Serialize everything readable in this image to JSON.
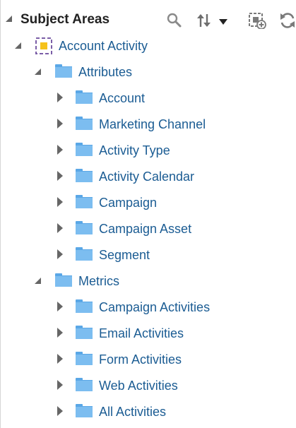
{
  "header": {
    "title": "Subject Areas"
  },
  "tree": {
    "root": {
      "label": "Account Activity",
      "icon": "subject-area-icon"
    },
    "attributes": {
      "label": "Attributes",
      "items": [
        {
          "label": "Account"
        },
        {
          "label": "Marketing Channel"
        },
        {
          "label": "Activity Type"
        },
        {
          "label": "Activity Calendar"
        },
        {
          "label": "Campaign"
        },
        {
          "label": "Campaign Asset"
        },
        {
          "label": "Segment"
        }
      ]
    },
    "metrics": {
      "label": "Metrics",
      "items": [
        {
          "label": "Campaign Activities"
        },
        {
          "label": "Email Activities"
        },
        {
          "label": "Form Activities"
        },
        {
          "label": "Web Activities"
        },
        {
          "label": "All Activities"
        }
      ]
    }
  },
  "colors": {
    "label": "#1b5c93",
    "folder": "#7cbdf0",
    "arrow": "#666666"
  }
}
